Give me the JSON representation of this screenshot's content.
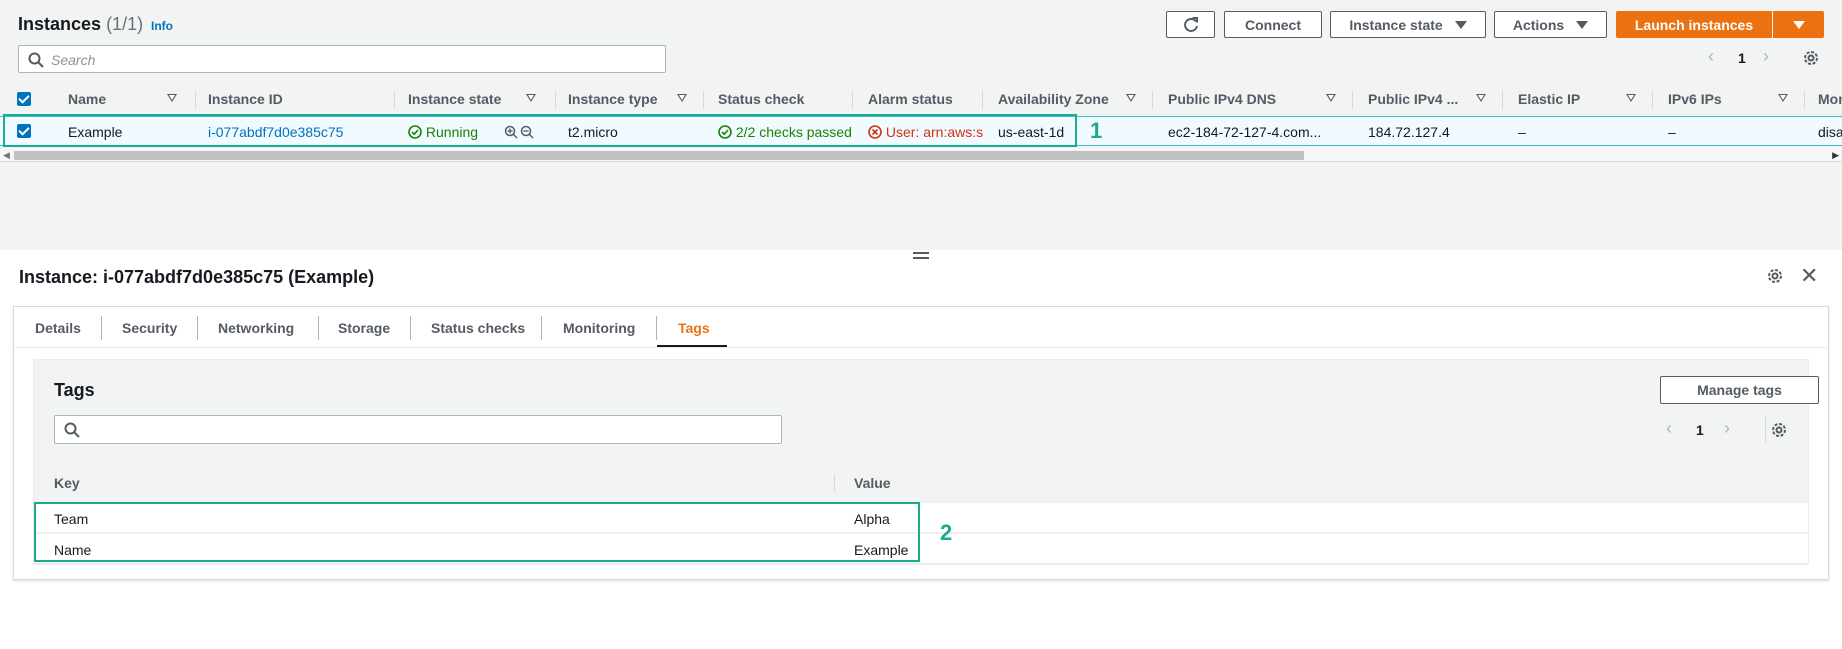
{
  "header": {
    "title": "Instances",
    "count": "(1/1)",
    "info": "Info",
    "connect_label": "Connect",
    "instance_state_label": "Instance state",
    "actions_label": "Actions",
    "launch_label": "Launch instances",
    "search_placeholder": "Search",
    "page_number": "1"
  },
  "table": {
    "columns": [
      "Name",
      "Instance ID",
      "Instance state",
      "Instance type",
      "Status check",
      "Alarm status",
      "Availability Zone",
      "Public IPv4 DNS",
      "Public IPv4 ...",
      "Elastic IP",
      "IPv6 IPs",
      "Mon"
    ],
    "row": {
      "name": "Example",
      "instance_id": "i-077abdf7d0e385c75",
      "state": "Running",
      "type": "t2.micro",
      "status_check": "2/2 checks passed",
      "alarm_status": "User: arn:aws:s",
      "az": "us-east-1d",
      "dns": "ec2-184-72-127-4.com...",
      "ipv4": "184.72.127.4",
      "elastic_ip": "–",
      "ipv6": "–",
      "monitoring": "disa"
    }
  },
  "annotations": {
    "label1": "1",
    "label2": "2"
  },
  "detail": {
    "title": "Instance: i-077abdf7d0e385c75 (Example)",
    "tabs": [
      "Details",
      "Security",
      "Networking",
      "Storage",
      "Status checks",
      "Monitoring",
      "Tags"
    ],
    "active_tab": "Tags",
    "tags": {
      "title": "Tags",
      "manage_label": "Manage tags",
      "page_number": "1",
      "key_header": "Key",
      "value_header": "Value",
      "rows": [
        {
          "key": "Team",
          "value": "Alpha"
        },
        {
          "key": "Name",
          "value": "Example"
        }
      ]
    }
  },
  "colors": {
    "accent_orange": "#ec7211",
    "link_blue": "#0073bb",
    "success_green": "#1d8102",
    "error_red": "#d13212",
    "annotation_teal": "#1aab8c"
  }
}
